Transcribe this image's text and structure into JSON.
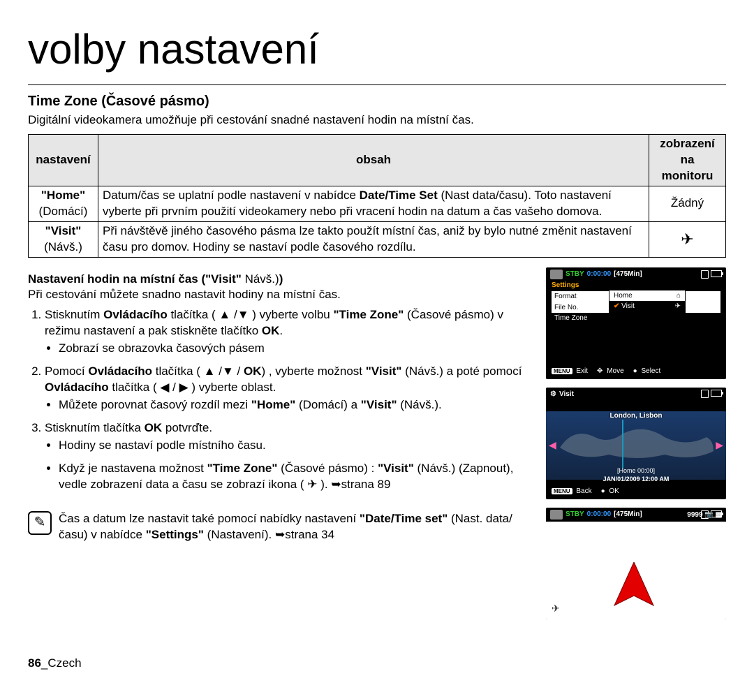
{
  "page": {
    "title": "volby nastavení",
    "section_title": "Time Zone (Časové pásmo)",
    "intro": "Digitální videokamera umožňuje při cestování snadné nastavení hodin na místní čas.",
    "footer_page": "86",
    "footer_lang": "Czech"
  },
  "table": {
    "headers": {
      "setting": "nastavení",
      "content": "obsah",
      "display": "zobrazení na monitoru"
    },
    "rows": [
      {
        "setting_line1": "\"Home\"",
        "setting_line2": "(Domácí)",
        "content_pre": "Datum/čas se uplatní podle nastavení v nabídce ",
        "content_bold": "Date/Time Set",
        "content_post": " (Nast data/času). Toto nastavení vyberte při prvním použití videokamery nebo při vracení hodin na datum a čas vašeho domova.",
        "display": "Žádný"
      },
      {
        "setting_line1": "\"Visit\"",
        "setting_line2": "(Návš.)",
        "content": "Při návštěvě jiného časového pásma lze takto použít místní čas, aniž by bylo nutné změnit nastavení času pro domov. Hodiny se nastaví podle časového rozdílu.",
        "display_icon": "plane-clock"
      }
    ]
  },
  "subheading": {
    "bold1": "Nastavení hodin na místní čas (",
    "bold2": "\"Visit\"",
    "plain": " Návš.)",
    "close": ")",
    "desc": "Při cestování můžete snadno nastavit hodiny na místní čas."
  },
  "steps": [
    {
      "parts": [
        "Stisknutím ",
        "Ovládacího",
        " tlačítka ( ▲ /▼ ) vyberte volbu ",
        "\"Time Zone\"",
        " (Časové pásmo) v režimu nastavení a pak stiskněte tlačítko ",
        "OK",
        "."
      ],
      "bullets": [
        "Zobrazí se obrazovka časových pásem"
      ]
    },
    {
      "parts": [
        "Pomocí ",
        "Ovládacího",
        " tlačítka ( ▲ /▼ / ",
        "OK",
        ") , vyberte možnost ",
        "\"Visit\"",
        " (Návš.) a poté pomocí ",
        "Ovládacího",
        " tlačítka ( ◀ / ▶ ) vyberte oblast."
      ],
      "bullets_rich": {
        "pre": "Můžete porovnat časový rozdíl mezi ",
        "b1": "\"Home\"",
        "mid1": " (Domácí) a ",
        "b2": "\"Visit\"",
        "post": " (Návš.)."
      }
    },
    {
      "parts": [
        "Stisknutím tlačítka ",
        "OK",
        " potvrďte."
      ],
      "bullets_list": [
        "Hodiny se nastaví podle místního času.",
        {
          "pre": "Když je nastavena možnost ",
          "b1": "\"Time Zone\"",
          "mid1": " (Časové pásmo) : ",
          "b2": "\"Visit\"",
          "mid2": " (Návš.) (Zapnout), vedle zobrazení data a času se zobrazí ikona ( ",
          "icon": "✈",
          "post": " ). ➥strana 89"
        }
      ]
    }
  ],
  "note": {
    "pre": "Čas a datum lze nastavit také pomocí nabídky nastavení ",
    "b1": "\"Date/Time set\"",
    "mid": " (Nast. data/času) v nabídce ",
    "b2": "\"Settings\"",
    "post": " (Nastavení). ➥strana 34"
  },
  "screens": {
    "s1": {
      "stby": "STBY",
      "time": "0:00:00",
      "min": "[475Min]",
      "settings": "Settings",
      "menu": [
        "Format",
        "File No.",
        "Time Zone"
      ],
      "popup_title": "Home",
      "popup_selected": "Visit",
      "foot_exit": "Exit",
      "foot_move": "Move",
      "foot_select": "Select",
      "foot_menu": "MENU"
    },
    "s2": {
      "title": "Visit",
      "cities": "London, Lisbon",
      "home_label": "[Home 00:00]",
      "date": "JAN/01/2009 12:00 AM",
      "foot_back": "Back",
      "foot_ok": "OK",
      "foot_menu": "MENU"
    },
    "s3": {
      "stby": "STBY",
      "time": "0:00:00",
      "min": "[475Min]",
      "count": "9999"
    }
  }
}
